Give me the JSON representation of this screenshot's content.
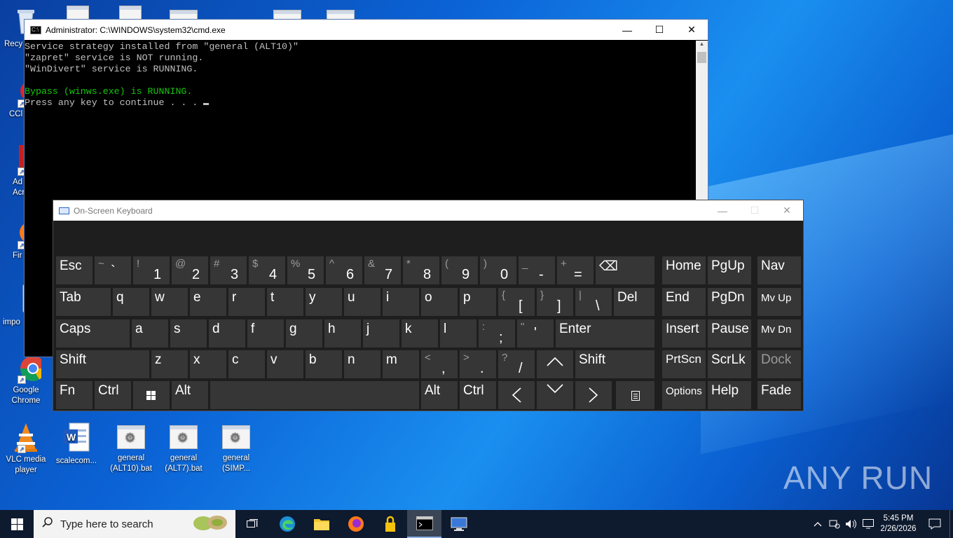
{
  "desktop": {
    "icons_left": [
      {
        "id": "recycle",
        "label": "Recy"
      },
      {
        "id": "ccleaner",
        "label": "CCl"
      },
      {
        "id": "acrobat",
        "label": "Ad\nAcr"
      },
      {
        "id": "firefox",
        "label": "Fir"
      },
      {
        "id": "import",
        "label": "impo"
      },
      {
        "id": "chrome",
        "label": "Google\nChrome"
      },
      {
        "id": "vlc",
        "label": "VLC media\nplayer"
      }
    ],
    "icons_bottom": [
      {
        "id": "scalecom",
        "label": "scalecom..."
      },
      {
        "id": "general-alt10",
        "label": "general\n(ALT10).bat"
      },
      {
        "id": "general-alt7",
        "label": "general\n(ALT7).bat"
      },
      {
        "id": "general-simp",
        "label": "general\n(SIMP..."
      }
    ],
    "watermark": "ANY RUN"
  },
  "cmd_window": {
    "title": "Administrator: C:\\WINDOWS\\system32\\cmd.exe",
    "lines": [
      "Service strategy installed from \"general (ALT10)\"",
      "\"zapret\" service is NOT running.",
      "\"WinDivert\" service is RUNNING.",
      "",
      "Bypass (winws.exe) is RUNNING.",
      "Press any key to continue . . . "
    ],
    "line_colors": [
      "#c0c0c0",
      "#c0c0c0",
      "#c0c0c0",
      "#c0c0c0",
      "#16c60c",
      "#c0c0c0"
    ]
  },
  "osk": {
    "title": "On-Screen Keyboard",
    "keys": {
      "esc": "Esc",
      "tilde_sm": "~",
      "tilde_big": "`",
      "k1s": "!",
      "k1": "1",
      "k2s": "@",
      "k2": "2",
      "k3s": "#",
      "k3": "3",
      "k4s": "$",
      "k4": "4",
      "k5s": "%",
      "k5": "5",
      "k6s": "^",
      "k6": "6",
      "k7s": "&",
      "k7": "7",
      "k8s": "*",
      "k8": "8",
      "k9s": "(",
      "k9": "9",
      "k0s": ")",
      "k0": "0",
      "minus_s": "_",
      "minus": "-",
      "plus_s": "+",
      "plus": "=",
      "home": "Home",
      "pgup": "PgUp",
      "nav": "Nav",
      "tab": "Tab",
      "q": "q",
      "w": "w",
      "e": "e",
      "r": "r",
      "t": "t",
      "y": "y",
      "u": "u",
      "i": "i",
      "o": "o",
      "p": "p",
      "lbr_s": "{",
      "lbr": "[",
      "rbr_s": "}",
      "rbr": "]",
      "bsl_s": "|",
      "bsl": "\\",
      "del": "Del",
      "end": "End",
      "pgdn": "PgDn",
      "mvup": "Mv Up",
      "caps": "Caps",
      "a": "a",
      "s": "s",
      "d": "d",
      "f": "f",
      "g": "g",
      "h": "h",
      "j": "j",
      "k": "k",
      "l": "l",
      "semi_s": ":",
      "semi": ";",
      "quote_s": "\"",
      "quote": "'",
      "enter": "Enter",
      "insert": "Insert",
      "pause": "Pause",
      "mvdn": "Mv Dn",
      "shift": "Shift",
      "z": "z",
      "x": "x",
      "c": "c",
      "v": "v",
      "b": "b",
      "n": "n",
      "m": "m",
      "comma_s": "<",
      "comma": ",",
      "dot_s": ">",
      "dot": ".",
      "slash_s": "?",
      "slash": "/",
      "up": "^",
      "rshift": "Shift",
      "prtscn": "PrtScn",
      "scrlk": "ScrLk",
      "dock": "Dock",
      "fn": "Fn",
      "ctrl": "Ctrl",
      "alt": "Alt",
      "ralt": "Alt",
      "rctrl": "Ctrl",
      "left": "<",
      "down": "v",
      "right": ">",
      "options": "Options",
      "help": "Help",
      "fade": "Fade"
    }
  },
  "taskbar": {
    "search_placeholder": "Type here to search",
    "time": "5:45 PM",
    "date": "2/26/2026"
  }
}
